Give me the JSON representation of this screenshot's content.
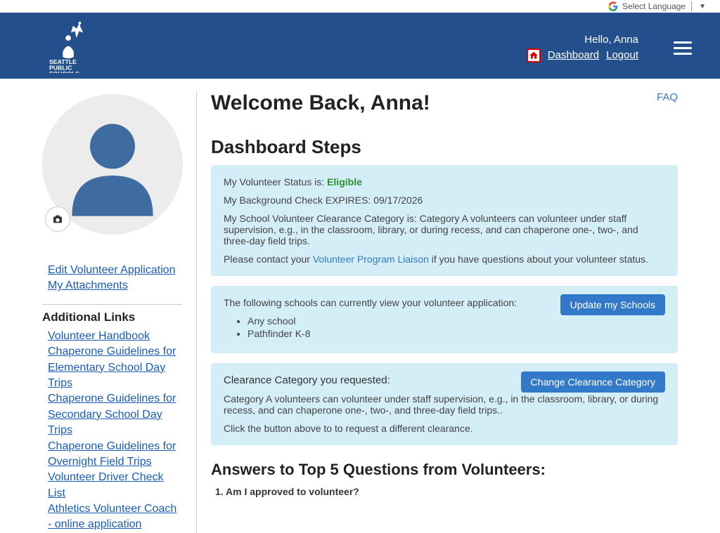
{
  "top": {
    "select_language": "Select Language"
  },
  "header": {
    "hello": "Hello, Anna",
    "dashboard": "Dashboard",
    "logout": "Logout"
  },
  "sidebar": {
    "edit_app": "Edit Volunteer Application",
    "my_attachments": "My Attachments",
    "additional_title": "Additional Links",
    "links": [
      "Volunteer Handbook",
      "Chaperone Guidelines for Elementary School Day Trips",
      "Chaperone Guidelines for Secondary School Day Trips",
      "Chaperone Guidelines for Overnight Field Trips",
      "Volunteer Driver Check List",
      "Athletics Volunteer Coach - online application"
    ]
  },
  "main": {
    "welcome": "Welcome Back, Anna!",
    "faq": "FAQ",
    "steps_title": "Dashboard Steps",
    "status_label": "My Volunteer Status is: ",
    "status_value": "Eligible",
    "bg_check": "My Background Check EXPIRES: 09/17/2026",
    "category_text": "My School Volunteer Clearance Category is: Category A volunteers can volunteer under staff supervision, e.g., in the classroom, library, or during recess, and can chaperone one-, two-, and three-day field trips.",
    "contact_pre": "Please contact your ",
    "contact_link": "Volunteer Program Liaison",
    "contact_post": " if you have questions about your volunteer status.",
    "schools_label": "The following schools can currently view your volunteer application:",
    "update_schools_btn": "Update my Schools",
    "schools": [
      "Any school",
      "Pathfinder K-8"
    ],
    "clearance_requested": "Clearance Category you requested:",
    "change_clearance_btn": "Change Clearance Category",
    "clearance_desc": "Category A volunteers can volunteer under staff supervision, e.g., in the classroom, library, or during recess, and can chaperone one-, two-, and three-day field trips..",
    "clearance_hint": "Click the button above to to request a different clearance.",
    "answers_title": "Answers to Top 5 Questions from Volunteers:",
    "q1": "1. Am I approved to volunteer?"
  }
}
